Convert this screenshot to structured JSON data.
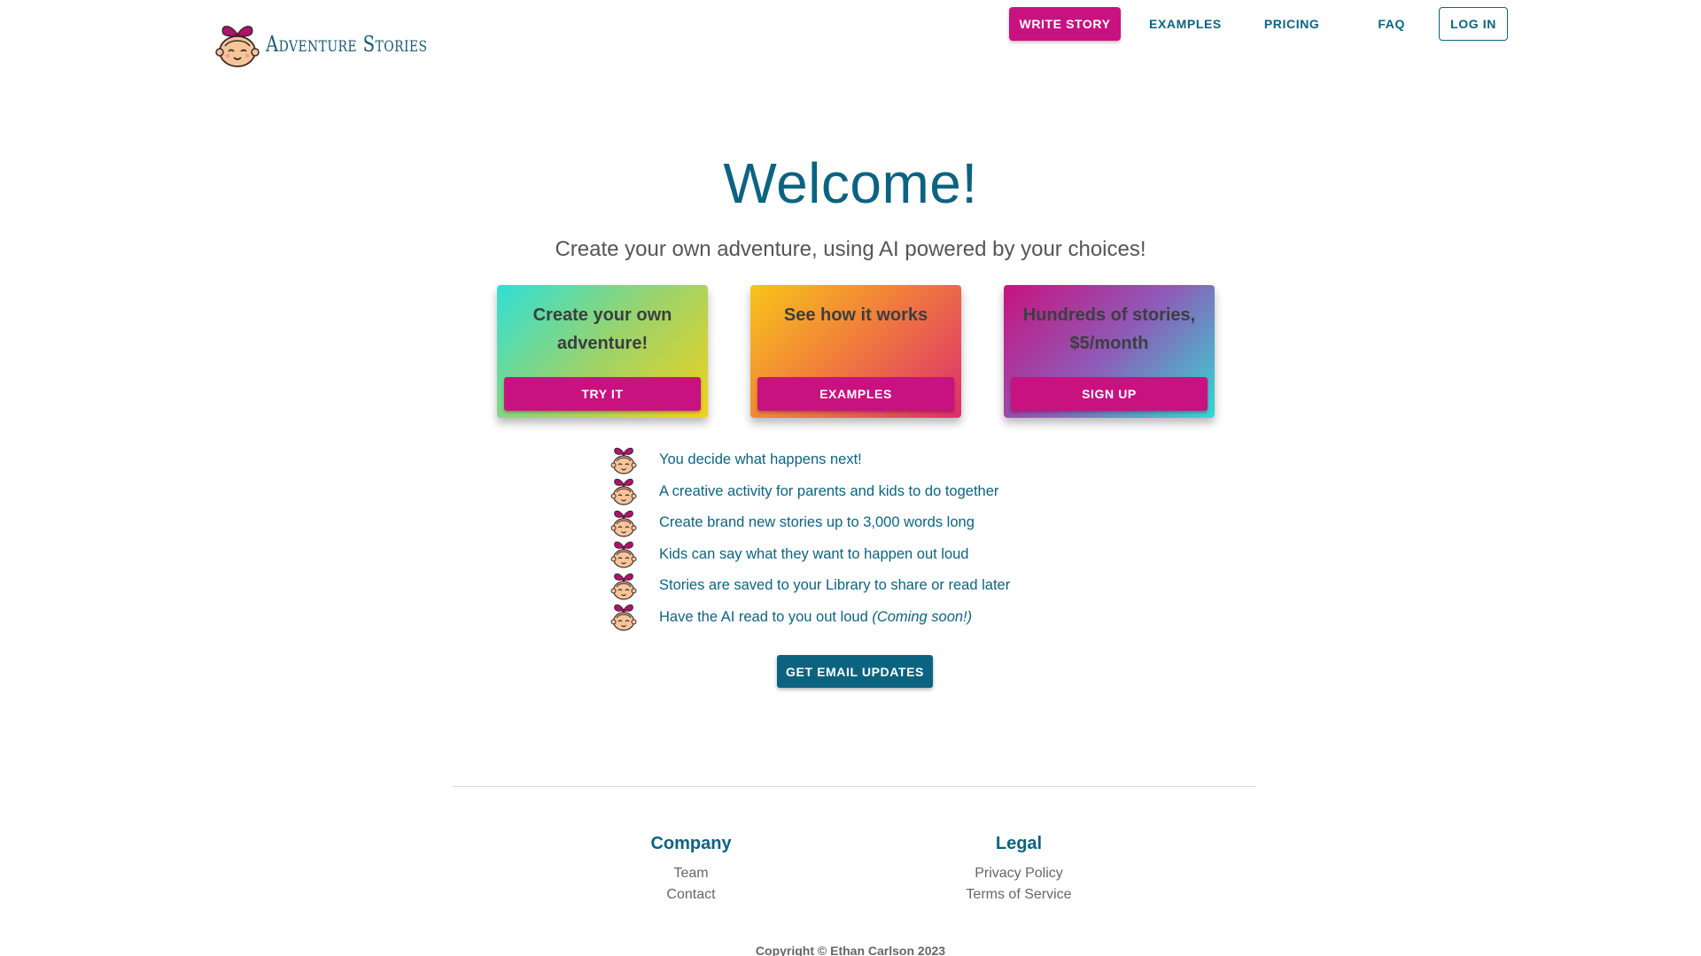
{
  "brand": {
    "name": "Adventure Stories",
    "logo_icon": "girl-face-icon"
  },
  "nav": {
    "write_story": "WRITE STORY",
    "examples": "EXAMPLES",
    "pricing": "PRICING",
    "faq": "FAQ",
    "login": "LOG IN"
  },
  "hero": {
    "title": "Welcome!",
    "subtitle": "Create your own adventure, using AI powered by your choices!"
  },
  "cards": [
    {
      "title": "Create your own adventure!",
      "button": "TRY IT"
    },
    {
      "title": "See how it works",
      "button": "EXAMPLES"
    },
    {
      "title": "Hundreds of stories, $5/month",
      "button": "SIGN UP"
    }
  ],
  "features": [
    {
      "text": "You decide what happens next!",
      "note": ""
    },
    {
      "text": "A creative activity for parents and kids to do together",
      "note": ""
    },
    {
      "text": "Create brand new stories up to 3,000 words long",
      "note": ""
    },
    {
      "text": "Kids can say what they want to happen out loud",
      "note": ""
    },
    {
      "text": "Stories are saved to your Library to share or read later",
      "note": ""
    },
    {
      "text": "Have the AI read to you out loud",
      "note": "(Coming soon!)"
    }
  ],
  "email_button": "GET EMAIL UPDATES",
  "footer": {
    "company": {
      "heading": "Company",
      "links": [
        "Team",
        "Contact"
      ]
    },
    "legal": {
      "heading": "Legal",
      "links": [
        "Privacy Policy",
        "Terms of Service"
      ]
    },
    "copyright": "Copyright © Ethan Carlson 2023"
  },
  "colors": {
    "primary": "#c8127f",
    "secondary": "#0c6380"
  }
}
